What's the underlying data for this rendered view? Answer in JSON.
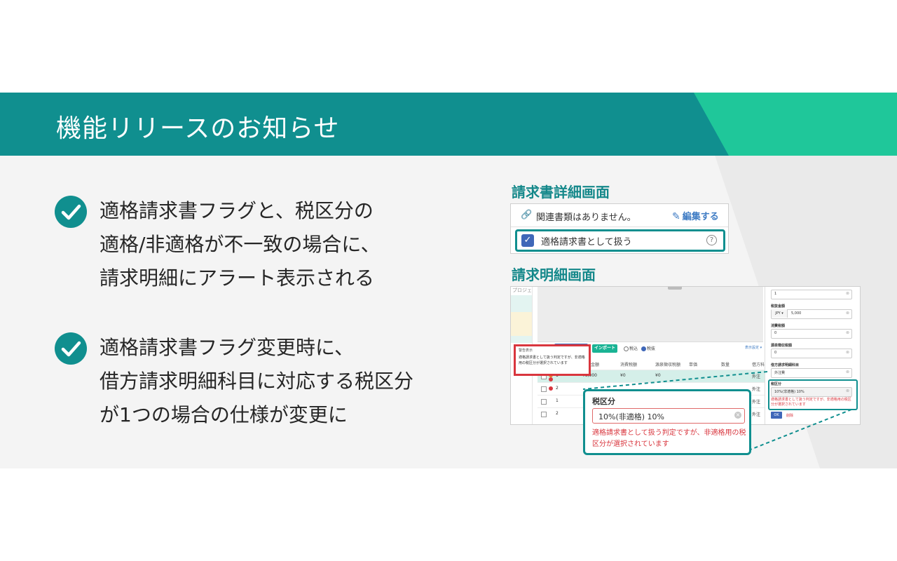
{
  "banner": {
    "title": "機能リリースのお知らせ"
  },
  "colors": {
    "teal": "#108f8f",
    "teal_light": "#1fc79a",
    "error": "#d9363e",
    "primary": "#3f67b8",
    "import": "#19b394"
  },
  "bullets": [
    {
      "icon": "check-circle",
      "lines": [
        "適格請求書フラグと、税区分の",
        "適格/非適格が不一致の場合に、",
        "請求明細にアラート表示される"
      ]
    },
    {
      "icon": "check-circle",
      "lines": [
        "適格請求書フラグ変更時に、",
        "借方請求明細科目に対応する税区分",
        "が1つの場合の仕様が変更に"
      ]
    }
  ],
  "detail_screen": {
    "heading": "請求書詳細画面",
    "related_text": "関連書類はありません。",
    "edit_label": "編集する",
    "qualified_label": "適格請求書として扱う",
    "qualified_checked": true,
    "help_icon": "?"
  },
  "lines_screen": {
    "heading": "請求明細画面",
    "side_label": "プロジェ",
    "import_label": "インポート",
    "radio_tax_included": "税込",
    "radio_tax_excluded": "税抜",
    "radio_selected": "税抜",
    "display_settings": "表示設定 ▾",
    "warning_title": "警告表示",
    "warning_message": "適格請求書として扱う判定ですが、非適格用の税区分が選択されています",
    "columns": [
      "税抜金額",
      "消費税額",
      "源泉徴収税額",
      "単価",
      "数量",
      "借方科目"
    ],
    "rows": [
      {
        "no": "1",
        "amount": "¥5,000",
        "tax": "¥0",
        "withholding": "¥0",
        "account": "外注",
        "highlight": true,
        "status": [
          "warning",
          "error"
        ]
      },
      {
        "no": "2",
        "amount": "",
        "tax": "",
        "withholding": "",
        "account": "外注",
        "highlight": false,
        "status": [
          "error"
        ]
      },
      {
        "no": "1",
        "amount": "",
        "tax": "",
        "withholding": "",
        "account": "外注",
        "highlight": false,
        "status": []
      },
      {
        "no": "2",
        "amount": "",
        "tax": "",
        "withholding": "",
        "account": "外注",
        "highlight": false,
        "status": []
      }
    ],
    "panel": {
      "quantity_value": "1",
      "amount_label": "税抜金額",
      "currency": "JPY ▾",
      "amount_value": "5,000",
      "tax_label": "消費税額",
      "tax_value": "0",
      "withholding_label": "源泉徴収税額",
      "withholding_value": "0",
      "account_label": "借方請求明細科目",
      "account_value": "外注費",
      "tax_category_label": "税区分",
      "tax_category_value": "10%(非適格) 10%",
      "tax_category_error": "適格請求書として扱う判定ですが、非適格用の税区分が選択されています",
      "ok_label": "OK",
      "cancel_label": "削除"
    },
    "zoom": {
      "label": "税区分",
      "value": "10%(非適格) 10%",
      "error": "適格請求書として扱う判定ですが、非適格用の税区分が選択されています"
    }
  }
}
